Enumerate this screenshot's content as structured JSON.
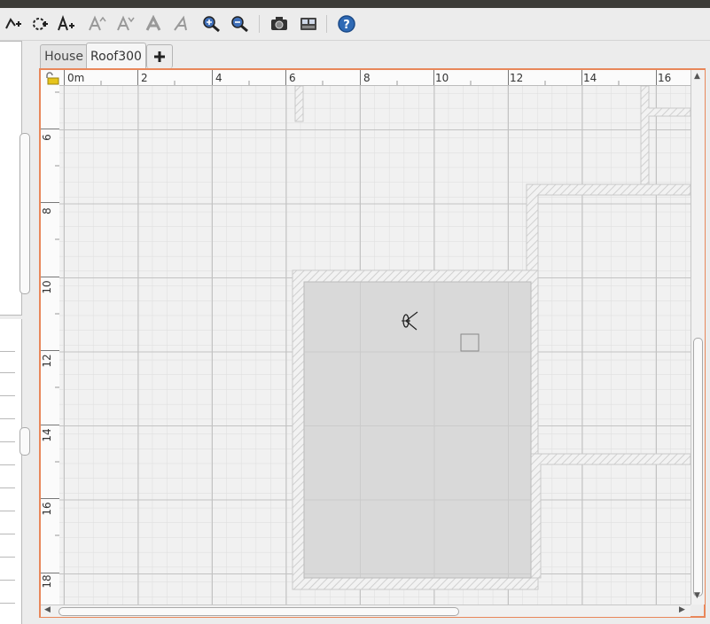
{
  "toolbar": {
    "items": [
      {
        "name": "create-polylines-button",
        "icon": "polyline-icon"
      },
      {
        "name": "create-dimensions-button",
        "icon": "dimension-icon"
      },
      {
        "name": "add-text-button",
        "icon": "text-add-icon"
      },
      {
        "name": "increase-text-size-button",
        "icon": "text-size-up-icon"
      },
      {
        "name": "decrease-text-size-button",
        "icon": "text-size-down-icon"
      },
      {
        "name": "bold-text-button",
        "icon": "text-bold-icon"
      },
      {
        "name": "italic-text-button",
        "icon": "text-italic-icon"
      },
      {
        "name": "zoom-in-button",
        "icon": "zoom-in-icon"
      },
      {
        "name": "zoom-out-button",
        "icon": "zoom-out-icon"
      },
      {
        "name": "create-photo-button",
        "icon": "camera-icon"
      },
      {
        "name": "create-video-button",
        "icon": "video-icon"
      },
      {
        "name": "help-button",
        "icon": "help-icon"
      }
    ]
  },
  "tabs": [
    {
      "label": "House",
      "active": false
    },
    {
      "label": "Roof300",
      "active": true
    }
  ],
  "add_level_icon": "plus-icon",
  "ruler_h": {
    "labels": [
      "0m",
      "2",
      "4",
      "6",
      "8",
      "10",
      "12",
      "14",
      "16"
    ]
  },
  "ruler_v": {
    "labels": [
      "6",
      "8",
      "10",
      "12",
      "14",
      "16",
      "18"
    ]
  },
  "colors": {
    "accent_border": "#e8875a",
    "room_fill": "#d9d9d9",
    "wall_hatch": "#c9c9c9",
    "grid_major": "#c4c4c4",
    "grid_minor": "#dcdcdc"
  },
  "lock_icon": "lock-icon",
  "camera_icon": "observer-camera-icon"
}
